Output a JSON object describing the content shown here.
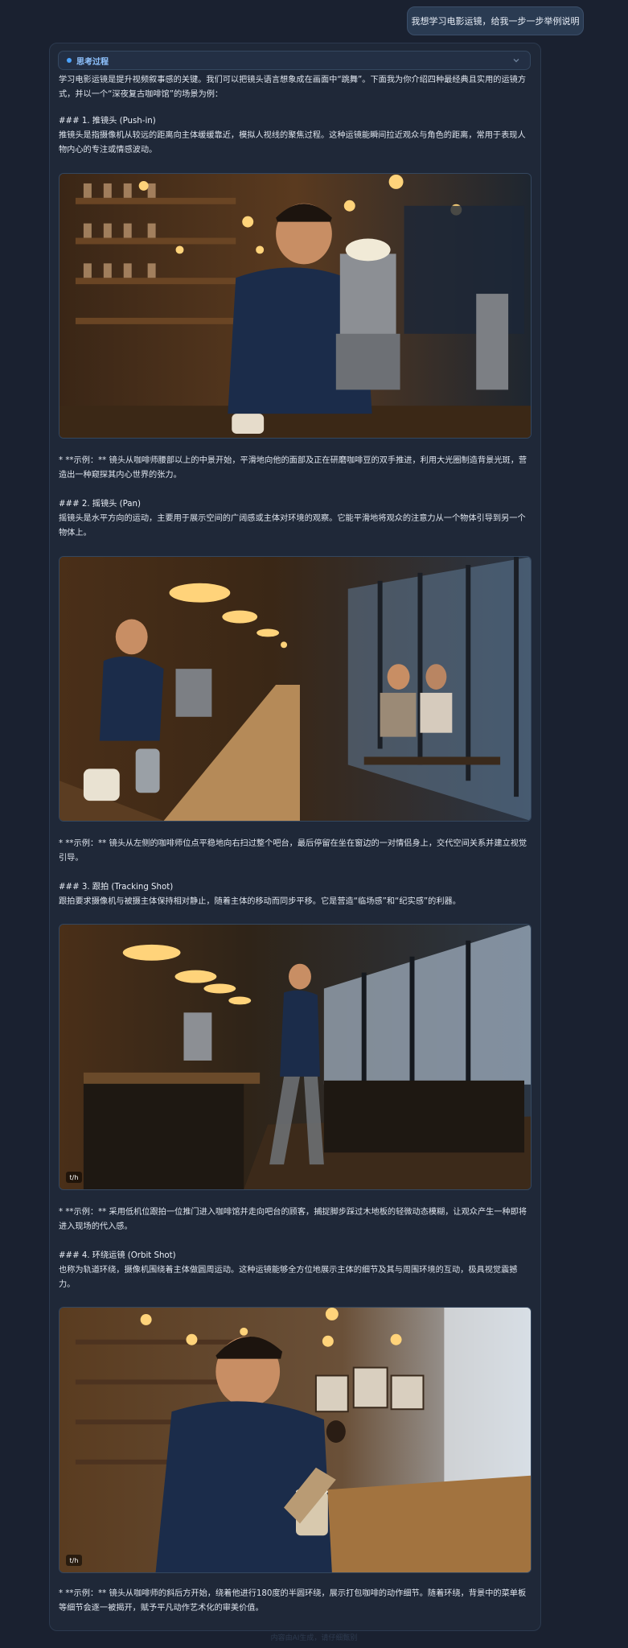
{
  "user_message": "我想学习电影运镜，给我一步一步举例说明",
  "thinking": {
    "label": "思考过程"
  },
  "intro": "学习电影运镜是提升视频叙事感的关键。我们可以把镜头语言想象成在画面中“跳舞”。下面我为你介绍四种最经典且实用的运镜方式，并以一个“深夜复古咖啡馆”的场景为例：",
  "sections": [
    {
      "heading": "### 1. 推镜头 (Push-in)",
      "desc": "推镜头是指摄像机从较远的距离向主体缓缓靠近，模拟人视线的聚焦过程。这种运镜能瞬间拉近观众与角色的距离，常用于表现人物内心的专注或情感波动。",
      "example": "* **示例：** 镜头从咖啡师腰部以上的中景开始，平滑地向他的面部及正在研磨咖啡豆的双手推进，利用大光圈制造背景光斑，营造出一种窥探其内心世界的张力。"
    },
    {
      "heading": "### 2. 摇镜头 (Pan)",
      "desc": "摇镜头是水平方向的运动，主要用于展示空间的广阔感或主体对环境的观察。它能平滑地将观众的注意力从一个物体引导到另一个物体上。",
      "example": "* **示例：** 镜头从左侧的咖啡师位点平稳地向右扫过整个吧台，最后停留在坐在窗边的一对情侣身上，交代空间关系并建立视觉引导。"
    },
    {
      "heading": "### 3. 跟拍 (Tracking Shot)",
      "desc": "跟拍要求摄像机与被摄主体保持相对静止，随着主体的移动而同步平移。它是营造“临场感”和“纪实感”的利器。",
      "example": "* **示例：** 采用低机位跟拍一位推门进入咖啡馆并走向吧台的顾客，捕捉脚步踩过木地板的轻微动态模糊，让观众产生一种即将进入现场的代入感。"
    },
    {
      "heading": "### 4. 环绕运镜 (Orbit Shot)",
      "desc": "也称为轨道环绕，摄像机围绕着主体做圆周运动。这种运镜能够全方位地展示主体的细节及其与周围环境的互动，极具视觉震撼力。",
      "example": "* **示例：** 镜头从咖啡师的斜后方开始，绕着他进行180度的半圆环绕，展示打包咖啡的动作细节。随着环绕，背景中的菜单板等细节会逐一被揭开，赋予平凡动作艺术化的审美价值。"
    }
  ],
  "image_badge": "t/h",
  "footer": "内容由AI生成，请仔细甄别"
}
